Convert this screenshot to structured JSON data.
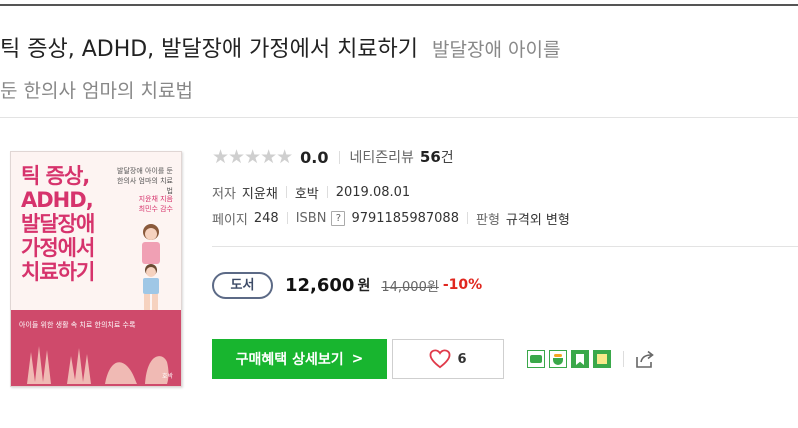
{
  "header": {
    "title": "틱 증상, ADHD, 발달장애 가정에서 치료하기",
    "subtitle_part1": "발달장애 아이를",
    "subtitle_part2": "둔 한의사 엄마의 치료법"
  },
  "cover": {
    "title_line1": "틱 증상,",
    "title_line2": "ADHD,",
    "title_line3": "발달장애",
    "title_line4": "가정에서",
    "title_line5": "치료하기",
    "subtitle": "발달장애 아이를 둔 한의사 엄마의 치료법",
    "author": "지윤채 지음 최민수 감수",
    "tagline": "아이들 위한 생활 속 치료 한의치료 수록",
    "publisher": "호박",
    "title_color": "#d6336c",
    "band_color": "#cf4a6b"
  },
  "rating": {
    "stars_filled": 0,
    "stars_total": 5,
    "score": "0.0",
    "review_label": "네티즌리뷰",
    "review_count": "56",
    "review_unit": "건"
  },
  "meta": {
    "author_label": "저자",
    "author": "지윤채",
    "publisher": "호박",
    "date": "2019.08.01",
    "pages_label": "페이지",
    "pages": "248",
    "isbn_label": "ISBN",
    "isbn_help": "?",
    "isbn": "9791185987088",
    "format_label": "판형",
    "format": "규격외 변형"
  },
  "price": {
    "badge": "도서",
    "price": "12,600",
    "price_unit": "원",
    "original": "14,000원",
    "discount": "-10%",
    "discount_color": "#e0271f"
  },
  "actions": {
    "buy_label": "구매혜택 상세보기",
    "buy_chevron": ">",
    "buy_color": "#18b52f",
    "like_count": "6",
    "share_icons": [
      "blog-share-icon",
      "cafe-share-icon",
      "bookmark-share-icon",
      "memo-share-icon",
      "export-share-icon"
    ]
  }
}
